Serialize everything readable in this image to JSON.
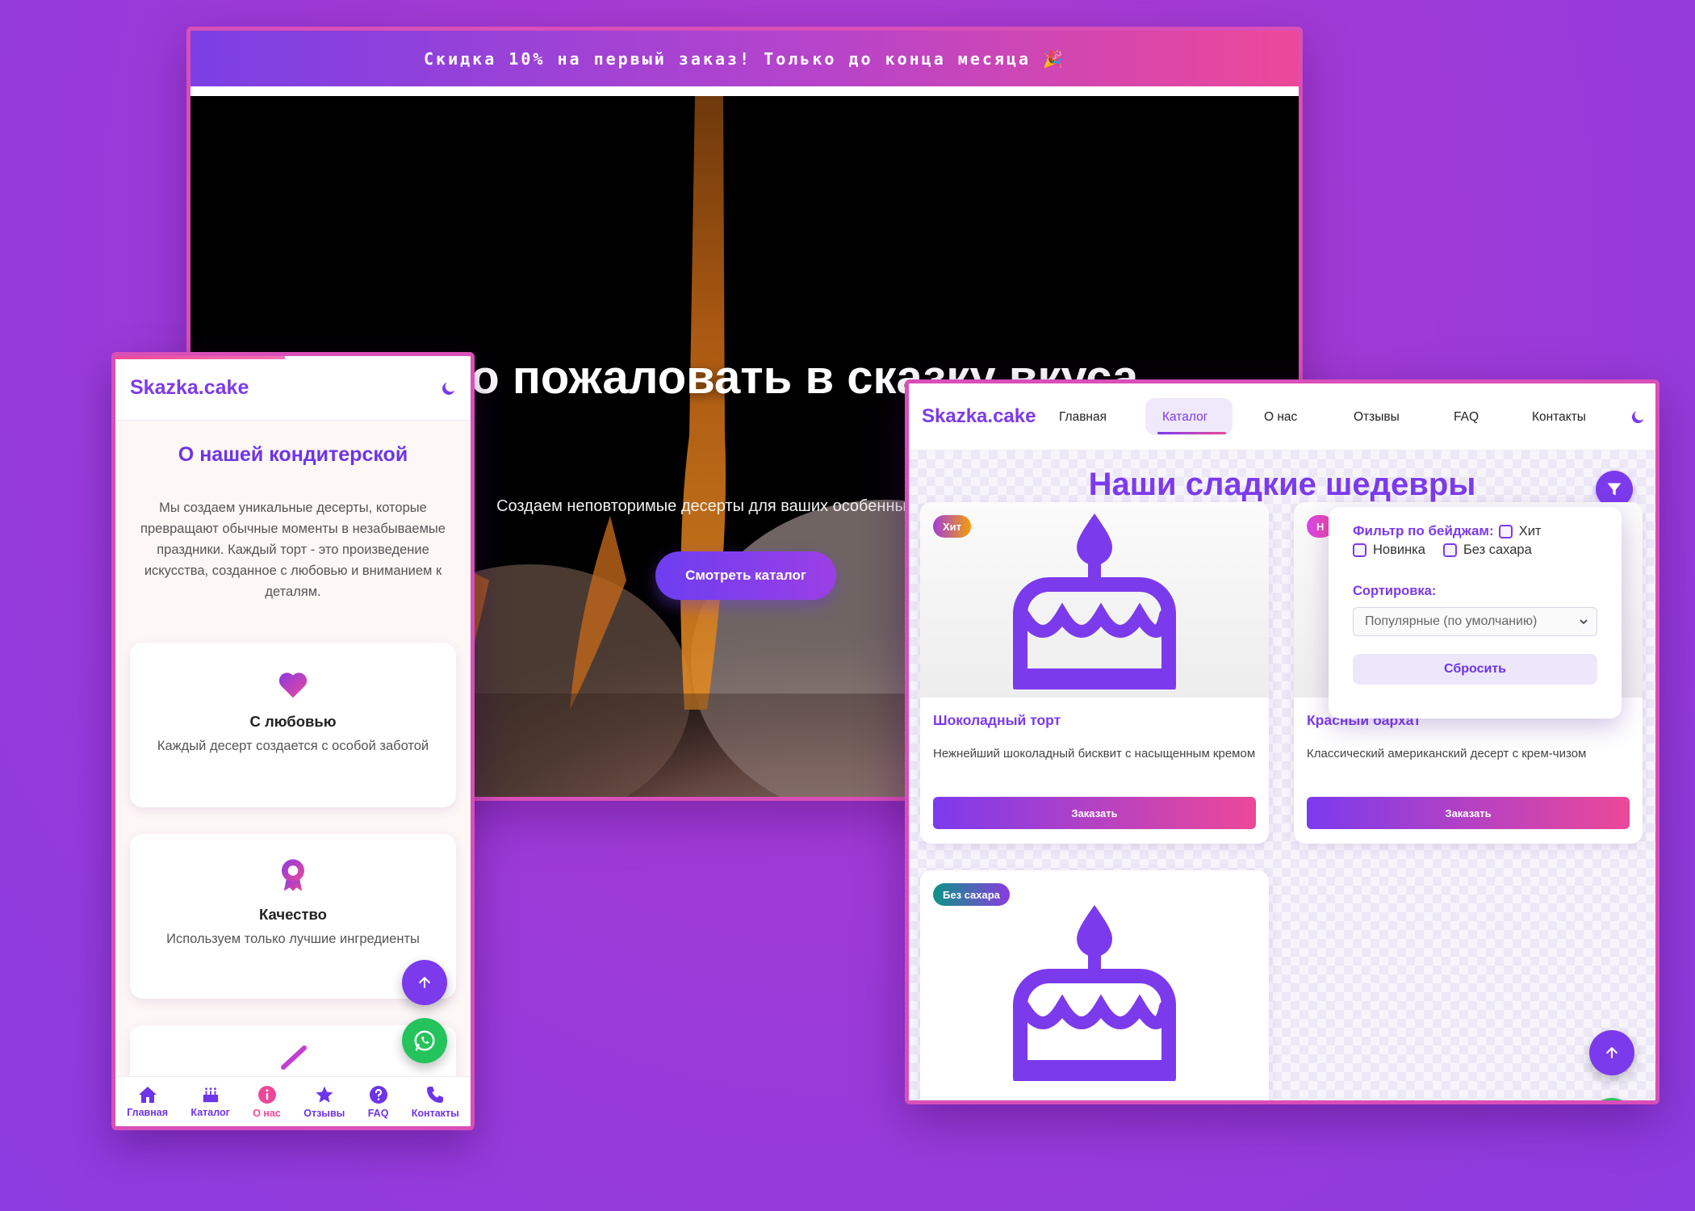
{
  "promo": {
    "text": "Скидка 10% на первый заказ! Только до конца месяца 🎉"
  },
  "hero": {
    "title": "Добро пожаловать в сказку вкуса",
    "subtitle": "Создаем неповторимые десерты для ваших особенных моментов",
    "cta": "Смотреть каталог"
  },
  "mobile": {
    "logo": "Skazka.cake",
    "section_title": "О нашей кондитерской",
    "about_text": "Мы создаем уникальные десерты, которые превращают обычные моменты в незабываемые праздники. Каждый торт - это произведение искусства, созданное с любовью и вниманием к деталям.",
    "features": [
      {
        "title": "С любовью",
        "text": "Каждый десерт создается с особой заботой",
        "icon": "heart-icon"
      },
      {
        "title": "Качество",
        "text": "Используем только лучшие ингредиенты",
        "icon": "award-icon"
      }
    ],
    "bottom_nav": [
      {
        "label": "Главная",
        "icon": "home-icon",
        "active": false
      },
      {
        "label": "Каталог",
        "icon": "cake-icon",
        "active": false
      },
      {
        "label": "О нас",
        "icon": "info-icon",
        "active": true
      },
      {
        "label": "Отзывы",
        "icon": "star-icon",
        "active": false
      },
      {
        "label": "FAQ",
        "icon": "question-icon",
        "active": false
      },
      {
        "label": "Контакты",
        "icon": "phone-icon",
        "active": false
      }
    ]
  },
  "catalog": {
    "logo": "Skazka.cake",
    "nav": [
      "Главная",
      "Каталог",
      "О нас",
      "Отзывы",
      "FAQ",
      "Контакты"
    ],
    "active_nav": "Каталог",
    "title": "Наши сладкие шедевры",
    "filter": {
      "badge_label": "Фильтр по бейджам:",
      "badges": [
        "Хит",
        "Новинка",
        "Без сахара"
      ],
      "sort_label": "Сортировка:",
      "sort_value": "Популярные (по умолчанию)",
      "reset": "Сбросить"
    },
    "products": [
      {
        "badge": "Хит",
        "name": "Шоколадный торт",
        "desc": "Нежнейший шоколадный бисквит с насыщенным кремом",
        "button": "Заказать"
      },
      {
        "badge": "Н",
        "name": "Красный бархат",
        "desc": "Классический американский десерт с крем-чизом",
        "button": "Заказать"
      },
      {
        "badge": "Без сахара",
        "name": "",
        "desc": "",
        "button": ""
      }
    ]
  },
  "colors": {
    "primary": "#7c3aed",
    "accent": "#ec4899",
    "whatsapp": "#25c35c"
  }
}
